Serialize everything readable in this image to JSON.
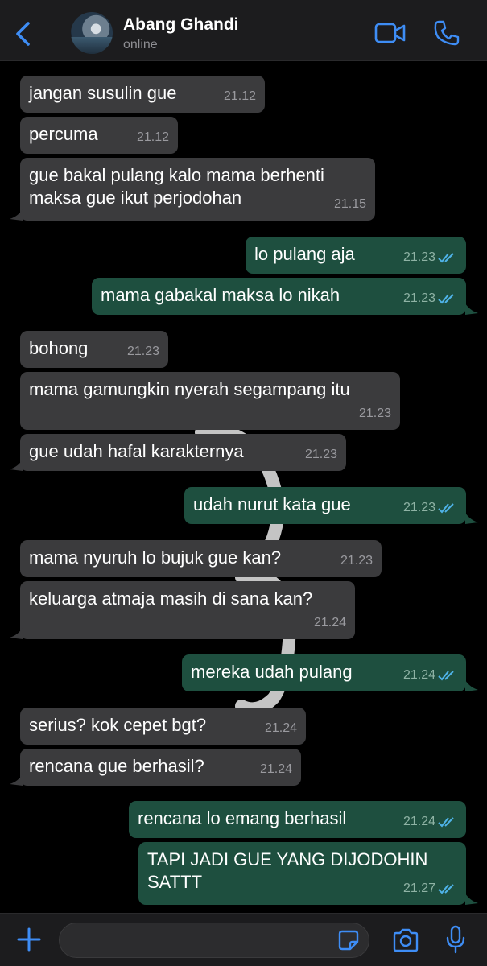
{
  "header": {
    "contact_name": "Abang Ghandi",
    "status": "online",
    "icons": [
      "chevron-left-icon",
      "avatar",
      "video-camera-icon",
      "phone-icon"
    ]
  },
  "colors": {
    "accent": "#3e8df5",
    "incoming_bubble": "#3b3b3d",
    "outgoing_bubble": "#1e4f3f",
    "read_ticks": "#4fb3e8"
  },
  "messages": [
    {
      "dir": "in",
      "text": "jangan susulin gue",
      "time": "21.12"
    },
    {
      "dir": "in",
      "text": "percuma",
      "time": "21.12"
    },
    {
      "dir": "in",
      "text": "gue bakal pulang kalo mama berhenti\nmaksa gue ikut perjodohan",
      "time": "21.15"
    },
    {
      "dir": "out",
      "text": "lo pulang aja",
      "time": "21.23"
    },
    {
      "dir": "out",
      "text": "mama gabakal maksa lo nikah",
      "time": "21.23"
    },
    {
      "dir": "in",
      "text": "bohong",
      "time": "21.23"
    },
    {
      "dir": "in",
      "text": "mama gamungkin nyerah segampang itu",
      "time": "21.23"
    },
    {
      "dir": "in",
      "text": "gue udah hafal karakternya",
      "time": "21.23"
    },
    {
      "dir": "out",
      "text": "udah nurut kata gue",
      "time": "21.23"
    },
    {
      "dir": "in",
      "text": "mama nyuruh lo bujuk gue kan?",
      "time": "21.23"
    },
    {
      "dir": "in",
      "text": "keluarga atmaja masih di sana kan?",
      "time": "21.24"
    },
    {
      "dir": "out",
      "text": "mereka udah pulang",
      "time": "21.24"
    },
    {
      "dir": "in",
      "text": "serius? kok cepet bgt?",
      "time": "21.24"
    },
    {
      "dir": "in",
      "text": "rencana gue berhasil?",
      "time": "21.24"
    },
    {
      "dir": "out",
      "text": "rencana lo emang berhasil",
      "time": "21.24"
    },
    {
      "dir": "out",
      "text": "TAPI JADI GUE YANG DIJODOHIN\nSATTT",
      "time": "21.27"
    }
  ],
  "composer": {
    "value": "",
    "icons": [
      "plus-icon",
      "sticker-icon",
      "camera-icon",
      "microphone-icon"
    ]
  }
}
